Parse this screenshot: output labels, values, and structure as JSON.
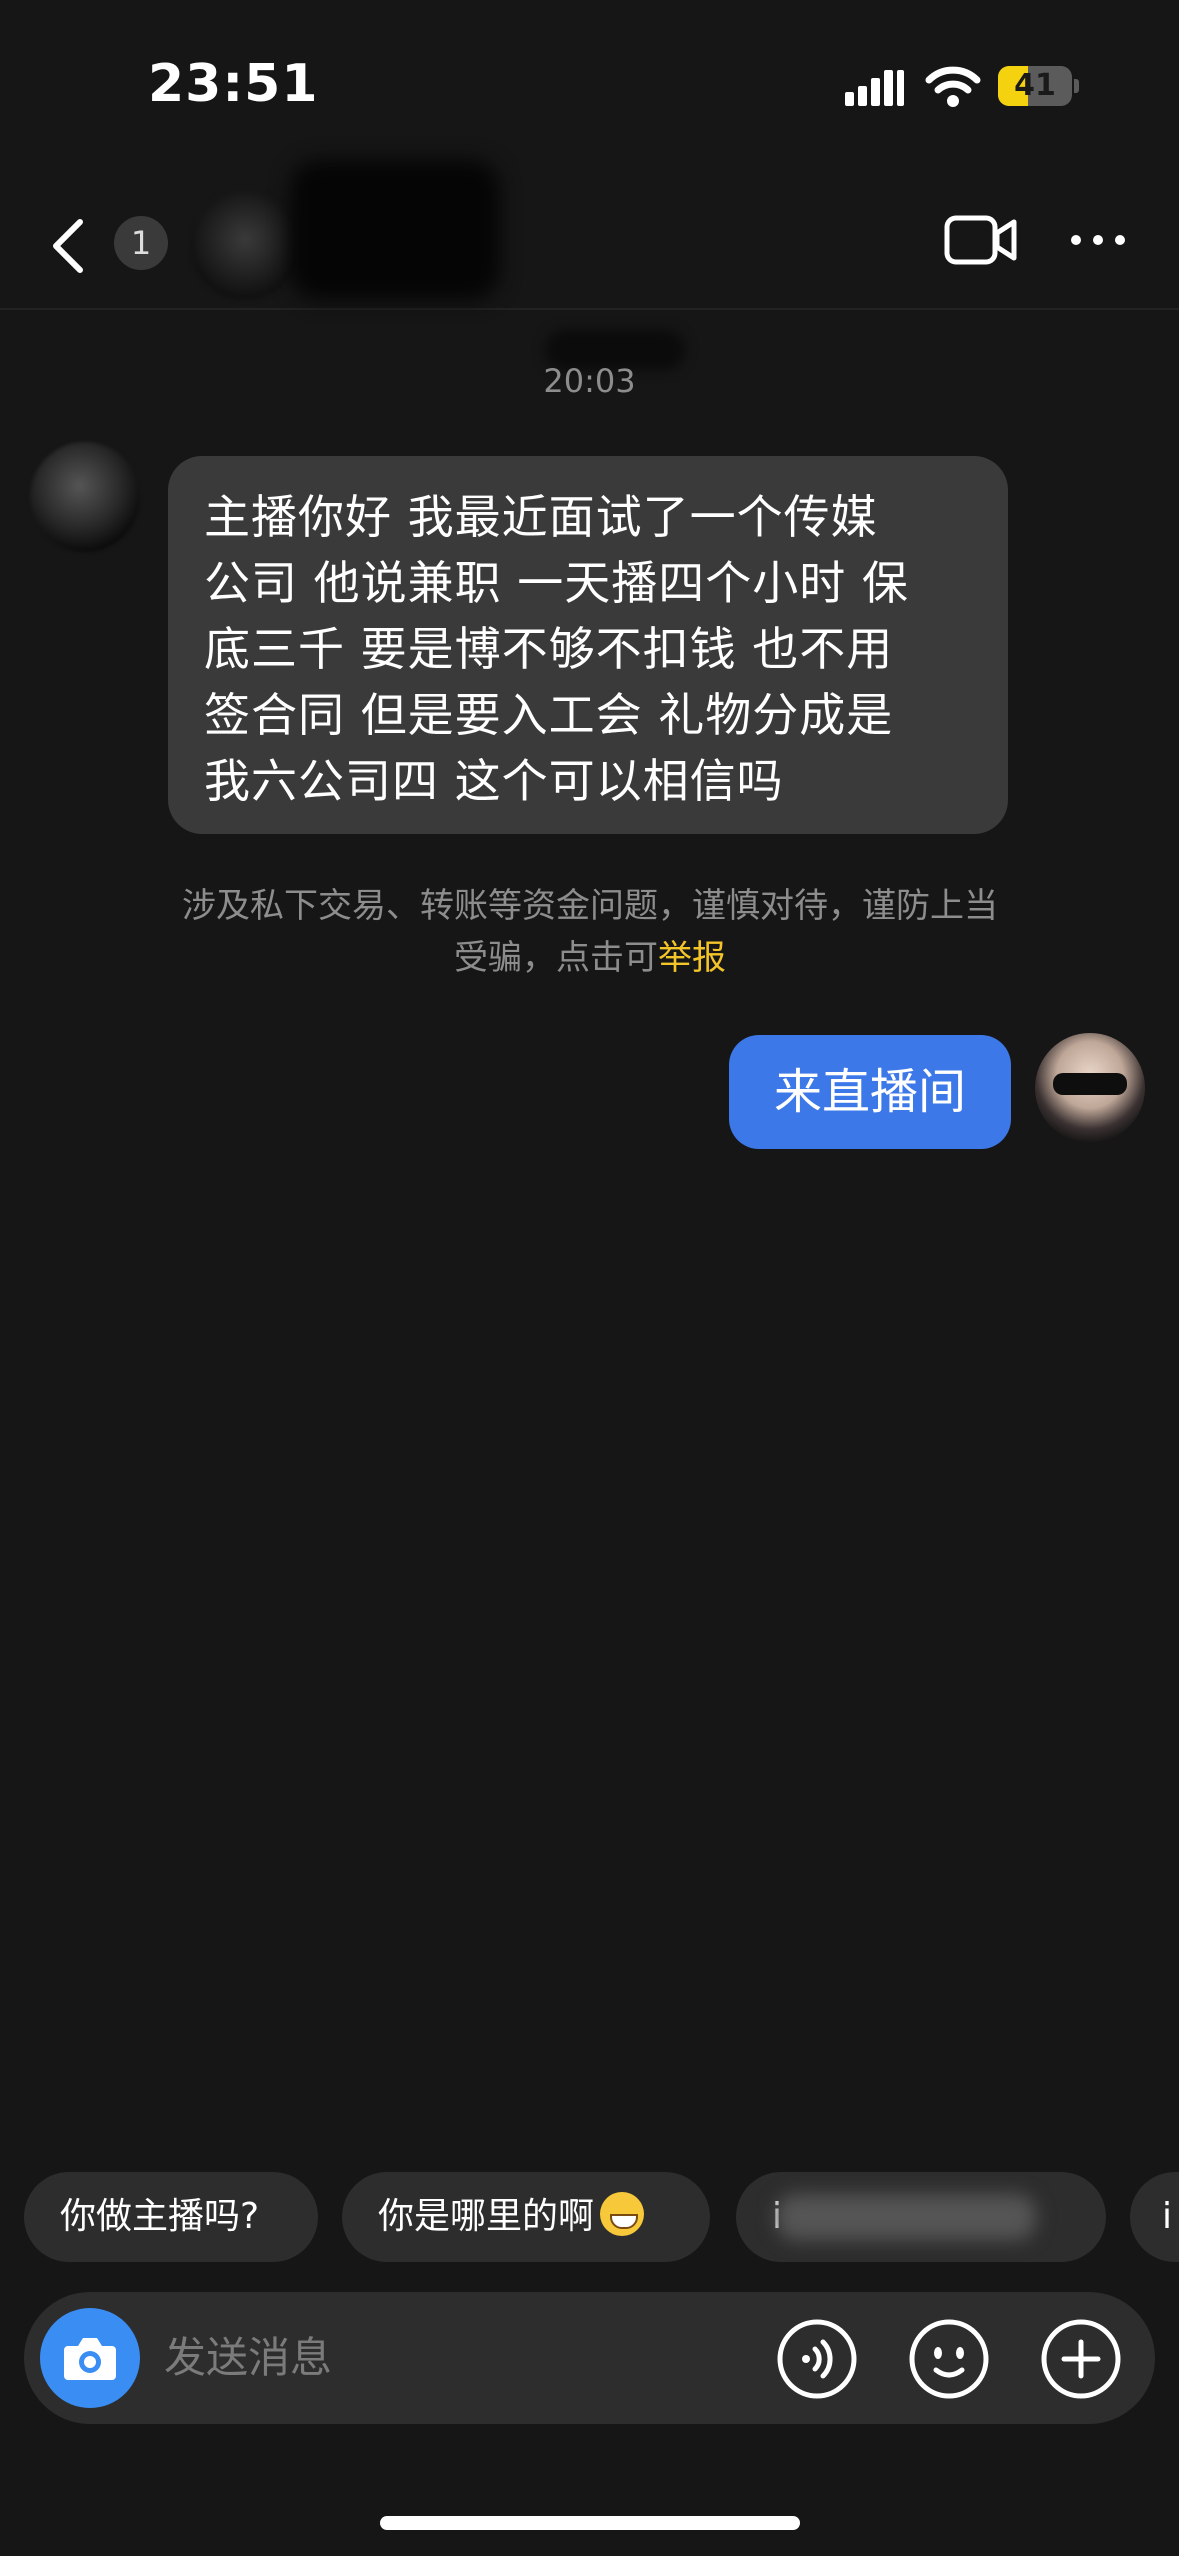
{
  "status_bar": {
    "time": "23:51",
    "battery_level": "41",
    "battery_fill_fraction": 0.41,
    "battery_color": "#f5d20f"
  },
  "nav": {
    "unread_count": "1",
    "icons": [
      "back-arrow-icon",
      "video-call-icon",
      "more-icon"
    ]
  },
  "chat": {
    "timestamp": "20:03",
    "incoming_message_lines": [
      "主播你好 我最近面试了一个传媒",
      "公司 他说兼职 一天播四个小时 保",
      "底三千 要是博不够不扣钱 也不用",
      "签合同 但是要入工会 礼物分成是",
      "我六公司四 这个可以相信吗"
    ],
    "warning_line1": "涉及私下交易、转账等资金问题，谨慎对待，谨防上当",
    "warning_line2": "受骗，点击可",
    "report_link": "举报",
    "outgoing_message": "来直播间",
    "outgoing_bubble_color": "#3d78e8"
  },
  "quick_replies": [
    {
      "label": "你做主播吗?"
    },
    {
      "label": "你是哪里的啊"
    },
    {
      "label": "i"
    },
    {
      "label": "i"
    }
  ],
  "input": {
    "placeholder": "发送消息",
    "camera_color": "#3a8df2",
    "icons": [
      "camera-icon",
      "voice-icon",
      "emoji-icon",
      "plus-icon"
    ]
  }
}
